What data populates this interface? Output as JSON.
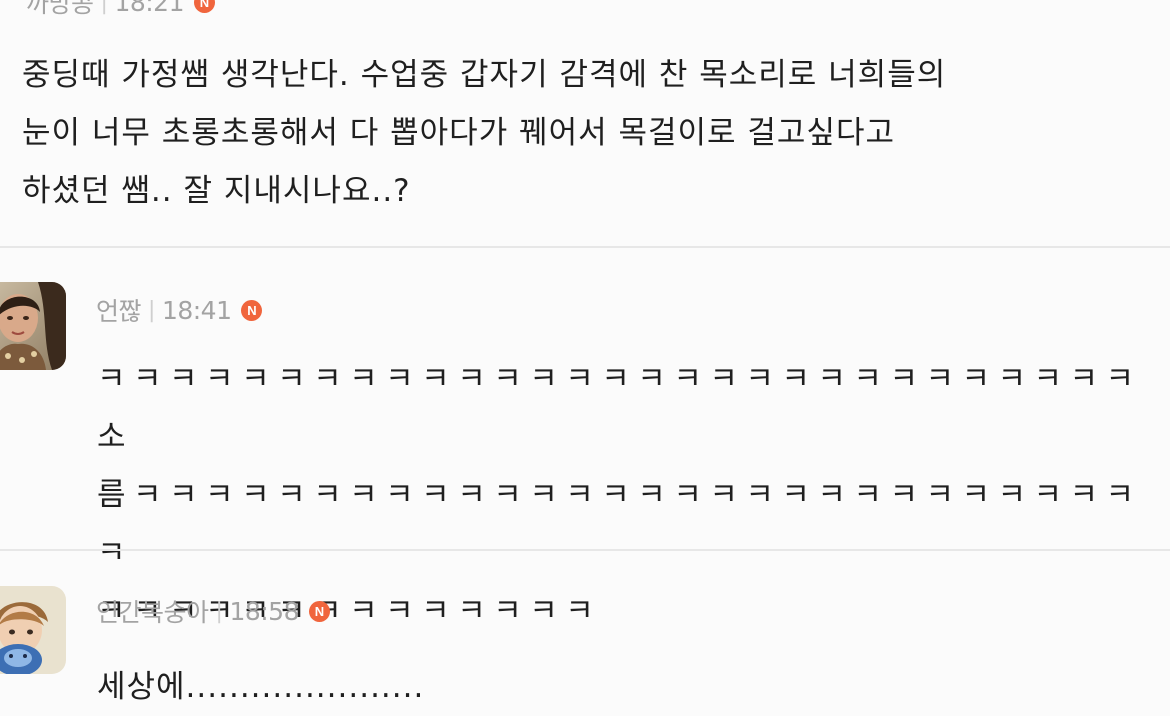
{
  "comments": [
    {
      "author": "까망콩",
      "time": "18:21",
      "badge": "N",
      "text": "중딩때 가정쌤 생각난다. 수업중 갑자기 감격에 찬 목소리로 너희들의\n눈이 너무 초롱초롱해서 다 뽑아다가 꿰어서 목걸이로 걸고싶다고\n하셨던 쌤.. 잘 지내시나요..?"
    },
    {
      "author": "언짢",
      "time": "18:41",
      "badge": "N",
      "text": "ㅋㅋㅋㅋㅋㅋㅋㅋㅋㅋㅋㅋㅋㅋㅋㅋㅋㅋㅋㅋㅋㅋㅋㅋㅋㅋㅋㅋㅋ소\n름ㅋㅋㅋㅋㅋㅋㅋㅋㅋㅋㅋㅋㅋㅋㅋㅋㅋㅋㅋㅋㅋㅋㅋㅋㅋㅋㅋㅋㅋ\nㅋㅋㅋㅋㅋㅋㅋㅋㅋㅋㅋㅋㅋㅋ"
    },
    {
      "author": "인간복숭아",
      "time": "18:58",
      "badge": "N",
      "text": "세상에......................"
    }
  ],
  "colors": {
    "background": "#fbfbfb",
    "divider": "#e7e7e7",
    "meta_text": "#a3a3a3",
    "badge": "#f0653d",
    "body_text": "#1f1f1f"
  },
  "icons": {
    "badge": "new-badge-icon",
    "avatar_2": "user-avatar-photo",
    "avatar_3": "user-avatar-photo"
  }
}
